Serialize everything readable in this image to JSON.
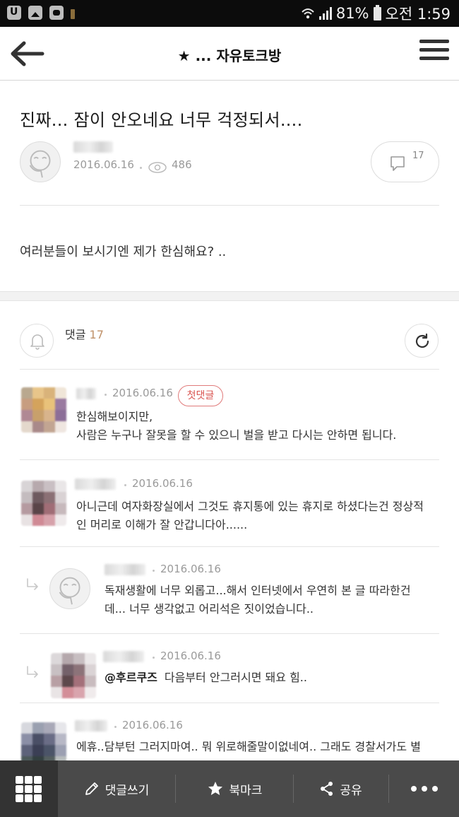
{
  "status_bar": {
    "battery_percent": "81%",
    "time": "오전 1:59"
  },
  "header": {
    "title": "★ ... 자유토크방"
  },
  "post": {
    "title": "진짜... 잠이 안오네요 너무 걱정되서....",
    "date": "2016.06.16",
    "views": "486",
    "comment_count": "17",
    "body": "여러분들이 보시기엔 제가 한심해요? .."
  },
  "comments_section": {
    "label": "댓글",
    "count": "17"
  },
  "comments": [
    {
      "date": "2016.06.16",
      "badge": "첫댓글",
      "lines": [
        "한심해보이지만,",
        "사람은 누구나 잘못을 할 수 있으니 벌을 받고 다시는 안하면 됩니다."
      ]
    },
    {
      "date": "2016.06.16",
      "lines": [
        "아니근데 여자화장실에서 그것도 휴지통에 있는 휴지로 하셨다는건 정상적",
        "인 머리로 이해가 잘 안갑니다아......"
      ]
    },
    {
      "date": "2016.06.16",
      "lines": [
        "독재생활에 너무 외롭고...해서 인터넷에서 우연히 본 글 따라한건",
        "데... 너무 생각없고 어리석은 짓이었습니다.."
      ]
    },
    {
      "date": "2016.06.16",
      "mention": "@후르쿠즈",
      "text": "다음부터 안그러시면 돼요 힘.."
    },
    {
      "date": "2016.06.16",
      "lines": [
        "에휴..담부턴 그러지마여.. 뭐 위로해줄말이없네여.. 그래도 경찰서가도 별"
      ]
    }
  ],
  "bottom_bar": {
    "write_comment": "댓글쓰기",
    "bookmark": "북마크",
    "share": "공유"
  }
}
